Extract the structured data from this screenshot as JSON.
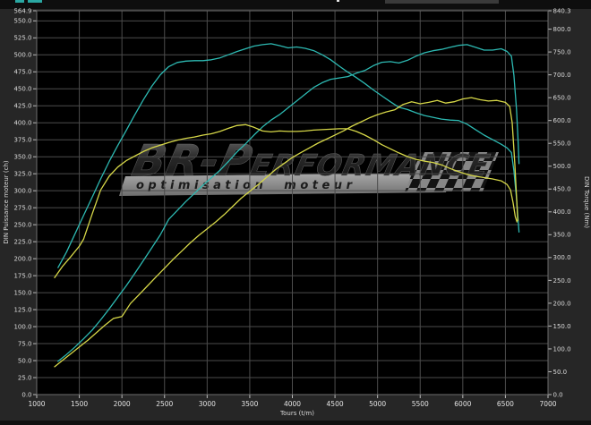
{
  "colors": {
    "background": "#262626",
    "top_strip": "#0e0e0e",
    "bottom_strip": "#101010",
    "plot_background": "#000000",
    "grid": "#4c4c4c",
    "frame": "#6e6e6e",
    "tuned_curve": "#2db9b2",
    "original_curve": "#d6d748",
    "watermark_banner": "#9a9a9a"
  },
  "watermark": {
    "brand_part1": "BR-P",
    "brand_part2": "ERFORMANCE",
    "tagline": "optimisation moteur"
  },
  "cropped_artifacts": {
    "top_left_fragment_color": "#2aa7a2",
    "top_center_dot_color": "#e8e8e8",
    "top_right_box_color": "#3a3a3a"
  },
  "chart_data": {
    "type": "line",
    "title": "",
    "xlabel": "Tours (t/m)",
    "ylabel_left": "DIN Puissance moteur (ch)",
    "ylabel_right": "DIN Torque (Nm)",
    "x_range": [
      1000,
      7000
    ],
    "y_left_range": [
      0,
      564.9
    ],
    "y_right_range": [
      0,
      840.3
    ],
    "grid": true,
    "legend": "none",
    "x_tick_labels": [
      "1000",
      "1500",
      "2000",
      "2500",
      "3000",
      "3500",
      "4000",
      "4500",
      "5000",
      "5500",
      "6000",
      "6500",
      "7000"
    ],
    "y_left_tick_labels": [
      "564.9",
      "550.0",
      "525.0",
      "500.0",
      "475.0",
      "450.0",
      "425.0",
      "400.0",
      "375.0",
      "350.0",
      "325.0",
      "300.0",
      "275.0",
      "250.0",
      "225.0",
      "200.0",
      "175.0",
      "150.0",
      "125.0",
      "100.0",
      "75.0",
      "50.0",
      "25.0",
      "0.0"
    ],
    "y_right_tick_labels": [
      "840.3",
      "800.0",
      "750.0",
      "700.0",
      "650.0",
      "600.0",
      "550.0",
      "500.0",
      "450.0",
      "400.0",
      "350.0",
      "300.0",
      "250.0",
      "200.0",
      "150.0",
      "100.0",
      "50.0",
      "0.0"
    ],
    "series": [
      {
        "name": "power-tuned",
        "axis": "left",
        "unit": "ch",
        "color": "#2db9b2",
        "peak": 515,
        "points": [
          [
            1250,
            49
          ],
          [
            1350,
            59
          ],
          [
            1450,
            70
          ],
          [
            1550,
            82
          ],
          [
            1650,
            95
          ],
          [
            1750,
            110
          ],
          [
            1850,
            126
          ],
          [
            1950,
            143
          ],
          [
            2050,
            160
          ],
          [
            2150,
            178
          ],
          [
            2250,
            197
          ],
          [
            2350,
            216
          ],
          [
            2450,
            235
          ],
          [
            2550,
            258
          ],
          [
            2650,
            271
          ],
          [
            2750,
            284
          ],
          [
            2850,
            296
          ],
          [
            2950,
            308
          ],
          [
            3050,
            319
          ],
          [
            3150,
            330
          ],
          [
            3250,
            343
          ],
          [
            3350,
            357
          ],
          [
            3450,
            369
          ],
          [
            3550,
            382
          ],
          [
            3650,
            394
          ],
          [
            3750,
            404
          ],
          [
            3850,
            412
          ],
          [
            3950,
            422
          ],
          [
            4050,
            432
          ],
          [
            4150,
            442
          ],
          [
            4250,
            452
          ],
          [
            4350,
            459
          ],
          [
            4450,
            464
          ],
          [
            4550,
            466
          ],
          [
            4650,
            468
          ],
          [
            4750,
            473
          ],
          [
            4850,
            477
          ],
          [
            4950,
            484
          ],
          [
            5050,
            489
          ],
          [
            5150,
            490
          ],
          [
            5250,
            488
          ],
          [
            5350,
            492
          ],
          [
            5450,
            498
          ],
          [
            5550,
            503
          ],
          [
            5650,
            506
          ],
          [
            5750,
            508
          ],
          [
            5850,
            511
          ],
          [
            5950,
            514
          ],
          [
            6050,
            515
          ],
          [
            6150,
            511
          ],
          [
            6250,
            507
          ],
          [
            6350,
            507
          ],
          [
            6450,
            509
          ],
          [
            6520,
            505
          ],
          [
            6570,
            498
          ],
          [
            6600,
            470
          ],
          [
            6630,
            420
          ],
          [
            6650,
            370
          ],
          [
            6660,
            340
          ]
        ]
      },
      {
        "name": "torque-tuned",
        "axis": "right",
        "unit": "Nm",
        "color": "#2db9b2",
        "peak": 768,
        "points": [
          [
            1250,
            278
          ],
          [
            1350,
            312
          ],
          [
            1450,
            352
          ],
          [
            1550,
            392
          ],
          [
            1650,
            432
          ],
          [
            1750,
            472
          ],
          [
            1850,
            510
          ],
          [
            1950,
            545
          ],
          [
            2050,
            578
          ],
          [
            2150,
            612
          ],
          [
            2250,
            645
          ],
          [
            2350,
            675
          ],
          [
            2450,
            700
          ],
          [
            2550,
            718
          ],
          [
            2650,
            727
          ],
          [
            2750,
            730
          ],
          [
            2850,
            731
          ],
          [
            2950,
            731
          ],
          [
            3050,
            733
          ],
          [
            3150,
            737
          ],
          [
            3250,
            744
          ],
          [
            3350,
            751
          ],
          [
            3450,
            757
          ],
          [
            3550,
            763
          ],
          [
            3650,
            766
          ],
          [
            3750,
            768
          ],
          [
            3850,
            764
          ],
          [
            3950,
            759
          ],
          [
            4050,
            761
          ],
          [
            4150,
            758
          ],
          [
            4250,
            753
          ],
          [
            4350,
            744
          ],
          [
            4450,
            733
          ],
          [
            4550,
            719
          ],
          [
            4650,
            706
          ],
          [
            4750,
            694
          ],
          [
            4850,
            681
          ],
          [
            4950,
            667
          ],
          [
            5050,
            654
          ],
          [
            5150,
            641
          ],
          [
            5250,
            629
          ],
          [
            5350,
            624
          ],
          [
            5450,
            617
          ],
          [
            5550,
            611
          ],
          [
            5650,
            607
          ],
          [
            5750,
            603
          ],
          [
            5850,
            601
          ],
          [
            5950,
            600
          ],
          [
            6050,
            592
          ],
          [
            6150,
            580
          ],
          [
            6250,
            568
          ],
          [
            6350,
            558
          ],
          [
            6450,
            548
          ],
          [
            6520,
            540
          ],
          [
            6570,
            530
          ],
          [
            6600,
            490
          ],
          [
            6630,
            430
          ],
          [
            6650,
            380
          ],
          [
            6660,
            356
          ]
        ]
      },
      {
        "name": "power-original",
        "axis": "left",
        "unit": "ch",
        "color": "#d6d748",
        "peak": 437,
        "points": [
          [
            1210,
            41
          ],
          [
            1300,
            50
          ],
          [
            1400,
            60
          ],
          [
            1500,
            70
          ],
          [
            1600,
            80
          ],
          [
            1700,
            91
          ],
          [
            1800,
            102
          ],
          [
            1900,
            112
          ],
          [
            2000,
            115
          ],
          [
            2100,
            134
          ],
          [
            2200,
            147
          ],
          [
            2300,
            160
          ],
          [
            2400,
            173
          ],
          [
            2500,
            186
          ],
          [
            2600,
            199
          ],
          [
            2700,
            211
          ],
          [
            2800,
            223
          ],
          [
            2900,
            234
          ],
          [
            3000,
            244
          ],
          [
            3100,
            254
          ],
          [
            3200,
            265
          ],
          [
            3300,
            277
          ],
          [
            3400,
            289
          ],
          [
            3500,
            299
          ],
          [
            3600,
            309
          ],
          [
            3700,
            320
          ],
          [
            3800,
            331
          ],
          [
            3900,
            340
          ],
          [
            4000,
            349
          ],
          [
            4100,
            356
          ],
          [
            4200,
            363
          ],
          [
            4300,
            370
          ],
          [
            4400,
            376
          ],
          [
            4500,
            382
          ],
          [
            4600,
            388
          ],
          [
            4700,
            395
          ],
          [
            4800,
            401
          ],
          [
            4900,
            407
          ],
          [
            5000,
            412
          ],
          [
            5100,
            416
          ],
          [
            5200,
            419
          ],
          [
            5300,
            427
          ],
          [
            5400,
            431
          ],
          [
            5500,
            428
          ],
          [
            5600,
            430
          ],
          [
            5700,
            433
          ],
          [
            5800,
            429
          ],
          [
            5900,
            431
          ],
          [
            6000,
            435
          ],
          [
            6100,
            437
          ],
          [
            6200,
            434
          ],
          [
            6300,
            432
          ],
          [
            6400,
            433
          ],
          [
            6500,
            430
          ],
          [
            6550,
            424
          ],
          [
            6580,
            400
          ],
          [
            6610,
            340
          ],
          [
            6635,
            280
          ],
          [
            6645,
            256
          ]
        ]
      },
      {
        "name": "torque-original",
        "axis": "right",
        "unit": "Nm",
        "color": "#d6d748",
        "peak": 591,
        "points": [
          [
            1210,
            256
          ],
          [
            1300,
            280
          ],
          [
            1400,
            302
          ],
          [
            1500,
            325
          ],
          [
            1550,
            340
          ],
          [
            1650,
            395
          ],
          [
            1750,
            448
          ],
          [
            1850,
            478
          ],
          [
            1950,
            498
          ],
          [
            2050,
            512
          ],
          [
            2150,
            522
          ],
          [
            2250,
            532
          ],
          [
            2350,
            540
          ],
          [
            2450,
            546
          ],
          [
            2550,
            552
          ],
          [
            2650,
            557
          ],
          [
            2750,
            561
          ],
          [
            2850,
            564
          ],
          [
            2950,
            568
          ],
          [
            3050,
            571
          ],
          [
            3150,
            576
          ],
          [
            3250,
            583
          ],
          [
            3350,
            589
          ],
          [
            3450,
            591
          ],
          [
            3550,
            585
          ],
          [
            3650,
            577
          ],
          [
            3750,
            575
          ],
          [
            3850,
            577
          ],
          [
            3950,
            576
          ],
          [
            4050,
            576
          ],
          [
            4150,
            577
          ],
          [
            4250,
            579
          ],
          [
            4350,
            580
          ],
          [
            4450,
            581
          ],
          [
            4550,
            582
          ],
          [
            4650,
            582
          ],
          [
            4750,
            576
          ],
          [
            4850,
            568
          ],
          [
            4950,
            558
          ],
          [
            5050,
            547
          ],
          [
            5150,
            538
          ],
          [
            5250,
            529
          ],
          [
            5350,
            521
          ],
          [
            5450,
            515
          ],
          [
            5550,
            511
          ],
          [
            5650,
            508
          ],
          [
            5750,
            503
          ],
          [
            5850,
            495
          ],
          [
            5950,
            488
          ],
          [
            6050,
            482
          ],
          [
            6150,
            478
          ],
          [
            6250,
            475
          ],
          [
            6350,
            472
          ],
          [
            6450,
            468
          ],
          [
            6520,
            460
          ],
          [
            6560,
            448
          ],
          [
            6590,
            420
          ],
          [
            6615,
            390
          ],
          [
            6635,
            378
          ]
        ]
      }
    ]
  }
}
